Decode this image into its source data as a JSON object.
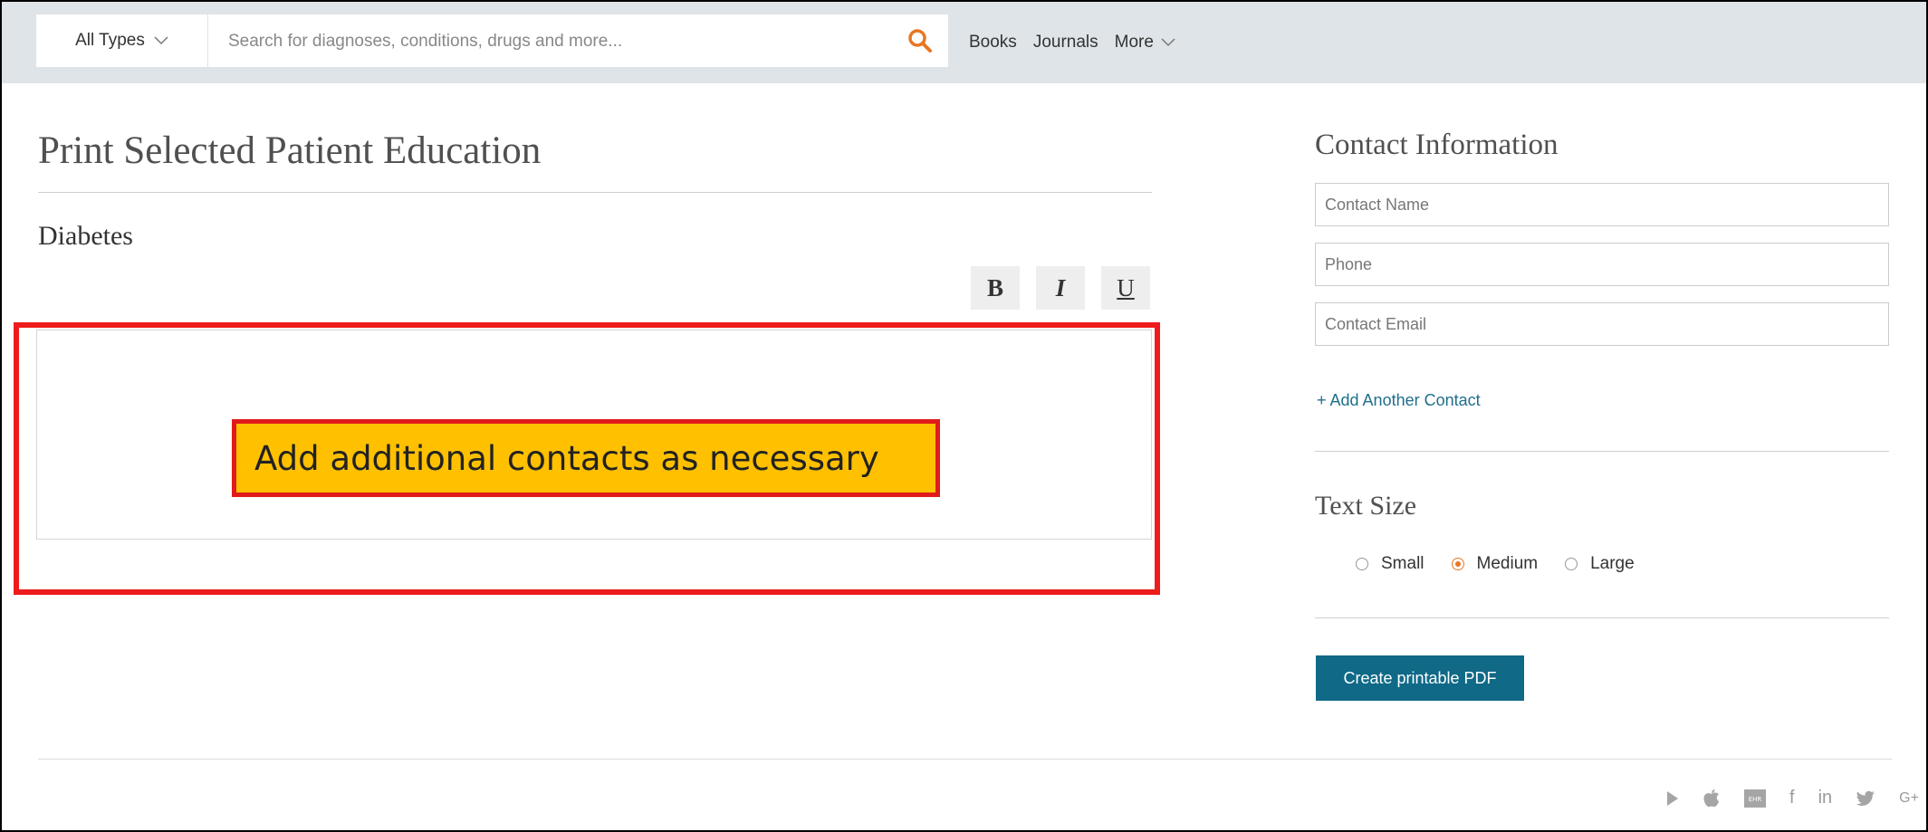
{
  "search": {
    "type_label": "All Types",
    "placeholder": "Search for diagnoses, conditions, drugs and more..."
  },
  "nav": {
    "books": "Books",
    "journals": "Journals",
    "more": "More"
  },
  "main": {
    "title": "Print Selected Patient Education",
    "subtitle": "Diabetes",
    "format": {
      "bold": "B",
      "italic": "I",
      "underline": "U"
    }
  },
  "callout": {
    "text": "Add additional contacts as necessary"
  },
  "contact": {
    "title": "Contact Information",
    "name_placeholder": "Contact Name",
    "phone_placeholder": "Phone",
    "email_placeholder": "Contact Email",
    "add_link": "+ Add Another Contact"
  },
  "text_size": {
    "title": "Text Size",
    "options": [
      "Small",
      "Medium",
      "Large"
    ],
    "selected": "Medium"
  },
  "actions": {
    "pdf": "Create printable PDF"
  },
  "footer": {
    "icons": [
      "google-play-icon",
      "apple-icon",
      "ehr-icon",
      "facebook-icon",
      "linkedin-icon",
      "twitter-icon",
      "google-plus-icon"
    ],
    "ehr_label": "EHR",
    "facebook": "f",
    "linkedin": "in",
    "googleplus": "G+"
  },
  "colors": {
    "accent": "#e87722",
    "button": "#0f6987",
    "link": "#1f6f8b",
    "callout_fill": "#ffc000",
    "callout_border": "#ee1c1c"
  }
}
